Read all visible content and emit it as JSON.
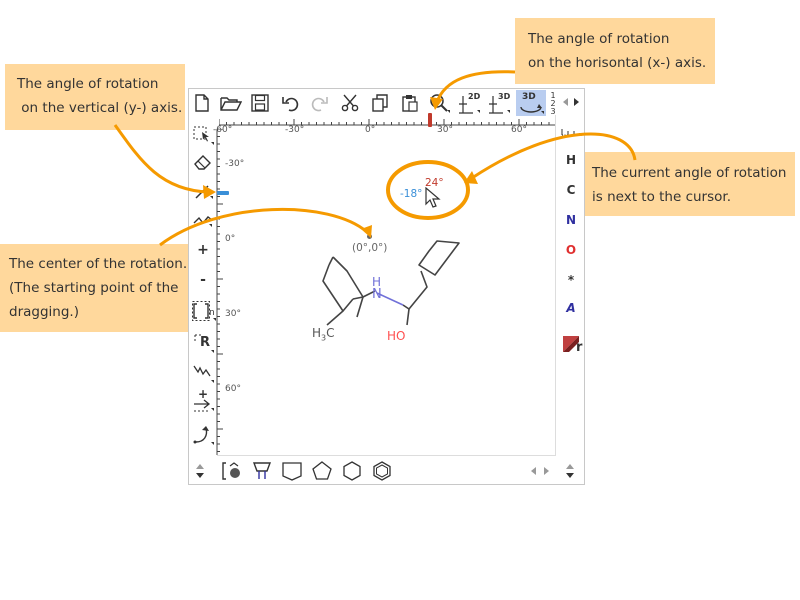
{
  "callouts": {
    "vertical_axis": "The angle of rotation\n on the vertical (y-) axis.",
    "horizontal_axis": "The angle of rotation\non the horisontal (x-) axis.",
    "current_angle": "The current angle of rotation\nis next to the cursor.",
    "center": "The center of the rotation.\n(The starting point of the\ndragging.)"
  },
  "toolbar_top": {
    "buttons": [
      "new-document-icon",
      "open-folder-icon",
      "save-icon",
      "undo-icon",
      "redo-icon",
      "cut-icon",
      "copy-icon",
      "paste-icon",
      "zoom-icon",
      "clean-2d-icon",
      "clean-3d-icon",
      "rotate-3d-icon",
      "scroll-arrows-icon"
    ],
    "label_2d": "2D",
    "label_3d": "3D",
    "label_3d_active": "3D",
    "label_123": [
      "1",
      "2",
      "3"
    ]
  },
  "ruler_top": [
    "-60°",
    "-30°",
    "0°",
    "30°",
    "60°"
  ],
  "ruler_left": [
    "-30°",
    "0°",
    "30°",
    "60°"
  ],
  "toolbar_left": {
    "plus": "+",
    "minus": "-",
    "bracket_sub": "n",
    "rgroup": "R",
    "plus_arrow": "+"
  },
  "atoms": [
    "H",
    "C",
    "N",
    "O",
    "*",
    "A"
  ],
  "periodic_label": "r",
  "molecule": {
    "nh_h": "H",
    "nh_n": "N",
    "ch3": "H",
    "ch3_sub": "3",
    "ch3_c": "C",
    "oh": "HO"
  },
  "rotation": {
    "center_label": "(0°,0°)",
    "x_angle": "-18°",
    "y_angle": "24°"
  },
  "colors": {
    "accent": "#f59a00",
    "callout_bg": "#ffd89c",
    "x_angle_color": "#3a8fd8",
    "y_angle_color": "#c0392b",
    "nitrogen": "#7070d8",
    "oxygen": "#ff5050",
    "active_button": "#b9cdf0"
  }
}
